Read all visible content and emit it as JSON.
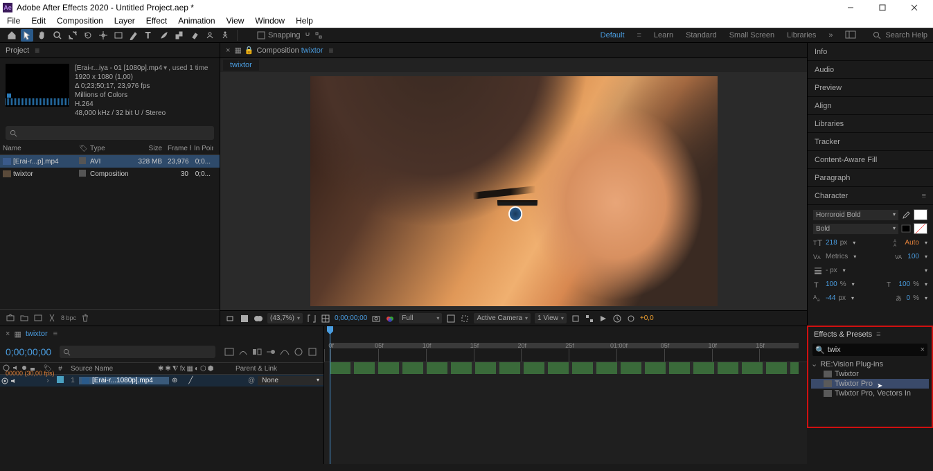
{
  "titlebar": {
    "app": "Adobe After Effects 2020 - Untitled Project.aep *"
  },
  "menu": [
    "File",
    "Edit",
    "Composition",
    "Layer",
    "Effect",
    "Animation",
    "View",
    "Window",
    "Help"
  ],
  "toolbar": {
    "snapping": "Snapping",
    "workspaces": [
      "Default",
      "Learn",
      "Standard",
      "Small Screen",
      "Libraries"
    ],
    "search_placeholder": "Search Help"
  },
  "project": {
    "tab": "Project",
    "file": {
      "name": "[Erai-r...iya - 01 [1080p].mp4",
      "used": ", used 1 time",
      "res": "1920 x 1080 (1,00)",
      "dur": "Δ 0;23;50;17, 23,976 fps",
      "colors": "Millions of Colors",
      "codec": "H.264",
      "audio": "48,000 kHz / 32 bit U / Stereo"
    },
    "columns": [
      "Name",
      "Type",
      "Size",
      "Frame R...",
      "In Point"
    ],
    "rows": [
      {
        "icon": "file",
        "name": "[Erai-r...p].mp4",
        "type": "AVI",
        "size": "328 MB",
        "fr": "23,976",
        "ip": "0;0..."
      },
      {
        "icon": "comp",
        "name": "twixtor",
        "type": "Composition",
        "size": "",
        "fr": "30",
        "ip": "0;0..."
      }
    ],
    "bpc": "8 bpc"
  },
  "composition": {
    "tab_prefix": "Composition",
    "tab_name": "twixtor",
    "crumb": "twixtor",
    "zoom": "(43,7%)",
    "timecode": "0;00;00;00",
    "res": "Full",
    "camera": "Active Camera",
    "views": "1 View",
    "offset": "+0,0"
  },
  "right_panels": [
    "Info",
    "Audio",
    "Preview",
    "Align",
    "Libraries",
    "Tracker",
    "Content-Aware Fill",
    "Paragraph"
  ],
  "character": {
    "title": "Character",
    "font": "Horroroid Bold",
    "weight": "Bold",
    "size": "218",
    "size_unit": "px",
    "leading": "Auto",
    "kerning": "Metrics",
    "tracking": "100",
    "stroke": "- px",
    "vscale": "100",
    "vscale_unit": "%",
    "hscale": "100",
    "hscale_unit": "%",
    "baseline": "-44",
    "baseline_unit": "px",
    "tsume": "0",
    "tsume_unit": "%"
  },
  "timeline": {
    "tab": "twixtor",
    "tc": "0;00;00;00",
    "tc_sub": "00000 (30,00 fps)",
    "header": {
      "source": "Source Name",
      "parent": "Parent & Link"
    },
    "layer": {
      "num": "1",
      "name": "[Erai-r...1080p].mp4",
      "parent": "None"
    },
    "ticks": [
      "0f",
      "05f",
      "10f",
      "15f",
      "20f",
      "25f",
      "01:00f",
      "05f",
      "10f",
      "15f"
    ]
  },
  "effects": {
    "title": "Effects & Presets",
    "search": "twix",
    "folder": "RE:Vision Plug-ins",
    "items": [
      "Twixtor",
      "Twixtor Pro",
      "Twixtor Pro, Vectors In"
    ]
  }
}
